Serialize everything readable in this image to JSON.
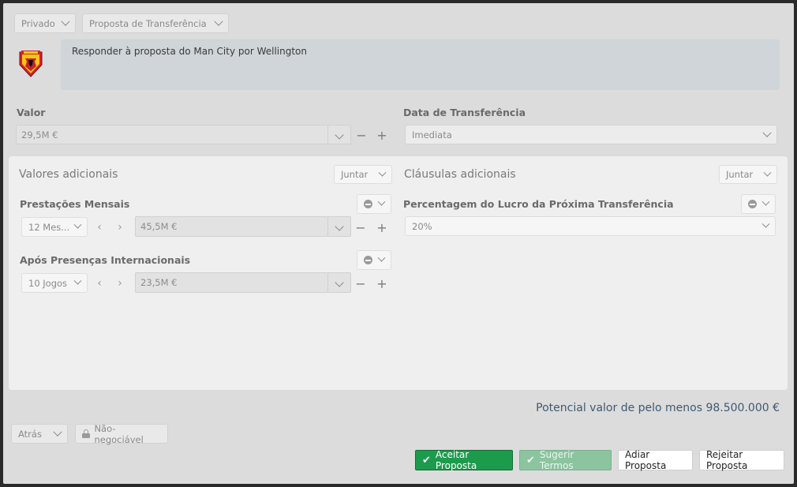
{
  "top": {
    "privacy_label": "Privado",
    "type_label": "Proposta de Transferência"
  },
  "message": {
    "text": "Responder à proposta do Man City por Wellington"
  },
  "value": {
    "label": "Valor",
    "amount": "29,5M €"
  },
  "transfer_date": {
    "label": "Data de Transferência",
    "value": "Imediata"
  },
  "additional_values": {
    "title": "Valores adicionais",
    "add_label": "Juntar",
    "items": [
      {
        "label": "Prestações Mensais",
        "count": "12 Mes...",
        "amount": "45,5M €"
      },
      {
        "label": "Após Presenças Internacionais",
        "count": "10 Jogos",
        "amount": "23,5M €"
      }
    ]
  },
  "additional_clauses": {
    "title": "Cláusulas adicionais",
    "add_label": "Juntar",
    "items": [
      {
        "label": "Percentagem do Lucro da Próxima Transferência",
        "value": "20%"
      }
    ]
  },
  "potential_total": "Potencial valor de pelo menos 98.500.000 €",
  "footer": {
    "back_label": "Atrás",
    "non_negotiable_label": "Não-negociável",
    "accept_label": "Aceitar Proposta",
    "suggest_label": "Sugerir Termos",
    "delay_label": "Adiar Proposta",
    "reject_label": "Rejeitar Proposta"
  },
  "colors": {
    "accept_green": "#1d9b4d",
    "total_text": "#3e5a72",
    "message_bg": "#cfd5d8"
  }
}
